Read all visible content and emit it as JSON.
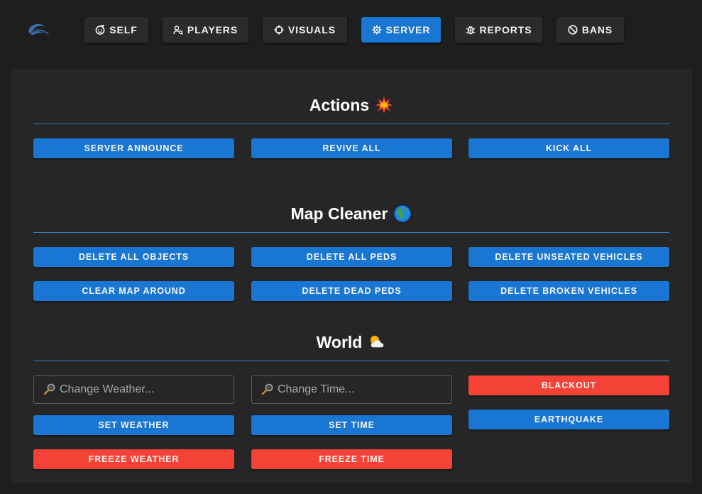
{
  "nav": {
    "tabs": [
      {
        "label": "SELF",
        "icon": "face-icon"
      },
      {
        "label": "PLAYERS",
        "icon": "players-icon"
      },
      {
        "label": "VISUALS",
        "icon": "crosshair-icon"
      },
      {
        "label": "SERVER",
        "icon": "gear-icon",
        "active": true
      },
      {
        "label": "REPORTS",
        "icon": "bug-icon"
      },
      {
        "label": "BANS",
        "icon": "ban-icon"
      }
    ]
  },
  "sections": {
    "actions": {
      "title": "Actions",
      "emoji": "collision-emoji",
      "buttons": [
        "SERVER ANNOUNCE",
        "REVIVE ALL",
        "KICK ALL"
      ]
    },
    "map_cleaner": {
      "title": "Map Cleaner",
      "emoji": "globe-emoji",
      "buttons": [
        "DELETE ALL OBJECTS",
        "DELETE ALL PEDS",
        "DELETE UNSEATED VEHICLES",
        "CLEAR MAP AROUND",
        "DELETE DEAD PEDS",
        "DELETE BROKEN VEHICLES"
      ]
    },
    "world": {
      "title": "World",
      "emoji": "sun-behind-cloud-emoji",
      "weather_placeholder": "Change Weather...",
      "time_placeholder": "Change Time...",
      "buttons": {
        "set_weather": "SET WEATHER",
        "set_time": "SET TIME",
        "freeze_weather": "FREEZE WEATHER",
        "freeze_time": "FREEZE TIME",
        "blackout": "BLACKOUT",
        "earthquake": "EARTHQUAKE"
      }
    }
  },
  "colors": {
    "accent": "#1976d2",
    "danger": "#f44336",
    "background": "#1e1e1e",
    "panel": "#262626",
    "tab": "#2b2b2b"
  }
}
